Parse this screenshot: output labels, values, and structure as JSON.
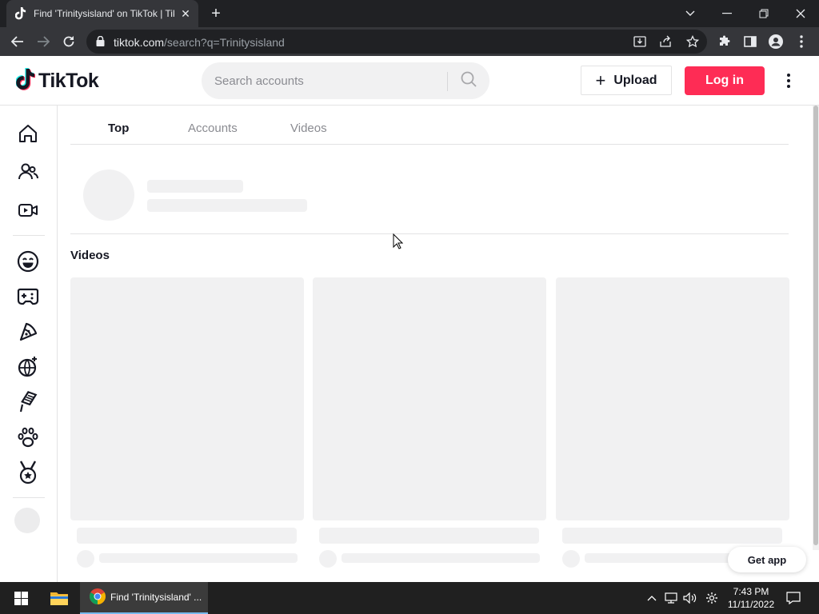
{
  "browser": {
    "tab_title": "Find 'Trinitysisland' on TikTok | TikTok Search",
    "new_tab_symbol": "+",
    "url_host": "tiktok.com",
    "url_path": "/search?q=Trinitysisland"
  },
  "header": {
    "logo_text": "TikTok",
    "search_placeholder": "Search accounts",
    "upload_label": "Upload",
    "upload_plus": "+",
    "login_label": "Log in"
  },
  "sidebar": {
    "icons": [
      "home-icon",
      "following-icon",
      "live-icon",
      "comedy-icon",
      "gaming-icon",
      "food-icon",
      "dance-icon",
      "beauty-icon",
      "animals-icon",
      "sports-icon"
    ]
  },
  "search_tabs": {
    "top": "Top",
    "accounts": "Accounts",
    "videos": "Videos"
  },
  "results": {
    "videos_heading": "Videos"
  },
  "get_app_label": "Get app",
  "taskbar": {
    "chrome_label": "Find 'Trinitysisland' ...",
    "time": "7:43 PM",
    "date": "11/11/2022"
  },
  "colors": {
    "brand_red": "#fe2c55",
    "tiktok_cyan": "#25f4ee",
    "text_dark": "#161823",
    "skeleton": "#f1f1f2"
  }
}
